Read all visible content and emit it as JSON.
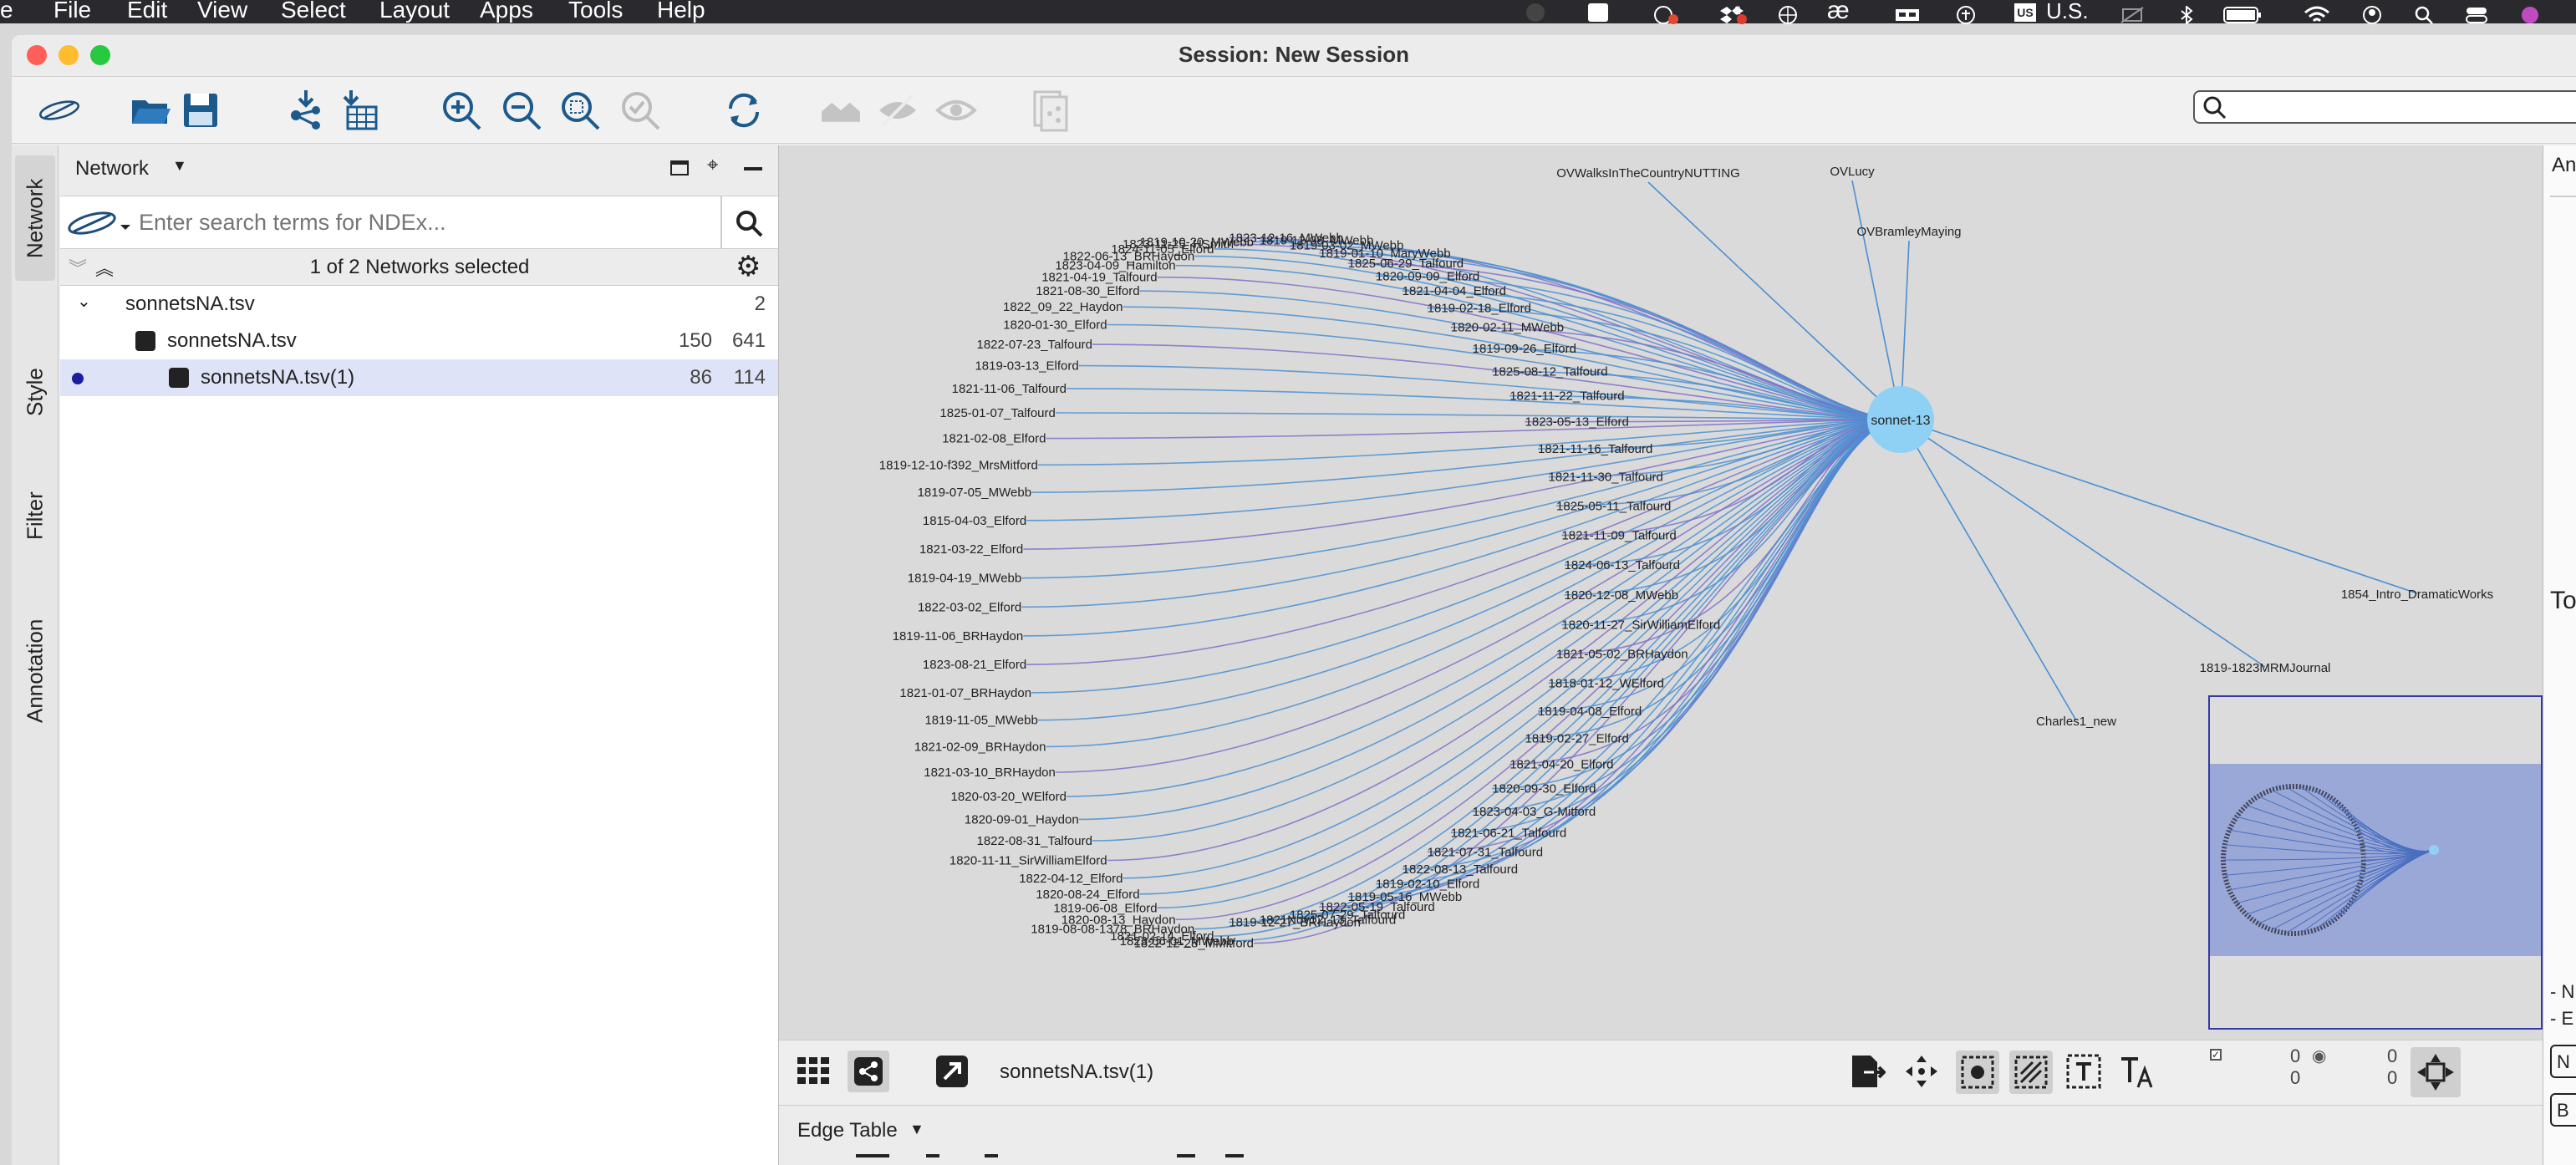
{
  "menubar": {
    "app_fragment": "e",
    "items": [
      "File",
      "Edit",
      "View",
      "Select",
      "Layout",
      "Apps",
      "Tools",
      "Help"
    ],
    "badge_count": "2",
    "input_source": "U.S."
  },
  "window": {
    "title": "Session: New Session"
  },
  "toolbar": {
    "icons": [
      "ndex-logo-icon",
      "open-folder-icon",
      "save-icon",
      "import-network-icon",
      "import-table-icon",
      "zoom-in-icon",
      "zoom-out-icon",
      "zoom-fit-icon",
      "zoom-selected-icon",
      "refresh-icon",
      "home-icon",
      "hide-icon",
      "show-icon",
      "new-network-icon"
    ]
  },
  "sidetabs": [
    "Network",
    "Style",
    "Filter",
    "Annotation"
  ],
  "network_panel": {
    "header_label": "Network",
    "search_placeholder": "Enter search terms for NDEx...",
    "selected_text": "1 of 2 Networks selected",
    "tree": [
      {
        "label": "sonnetsNA.tsv",
        "count1": "2",
        "count2": ""
      },
      {
        "label": "sonnetsNA.tsv",
        "count1": "150",
        "count2": "641"
      },
      {
        "label": "sonnetsNA.tsv(1)",
        "count1": "86",
        "count2": "114"
      }
    ]
  },
  "graph": {
    "hub": "sonnet-13",
    "left_nodes": [
      "1819-10-20_MWebb",
      "1823-11-25_HSmith",
      "1824-11-05_Elford",
      "1822-06-13_BRHaydon",
      "1823-04-09_Hamilton",
      "1821-04-19_Talfourd",
      "1821-08-30_Elford",
      "1822_09_22_Haydon",
      "1820-01-30_Elford",
      "1822-07-23_Talfourd",
      "1819-03-13_Elford",
      "1821-11-06_Talfourd",
      "1825-01-07_Talfourd",
      "1821-02-08_Elford",
      "1819-12-10-f392_MrsMitford",
      "1819-07-05_MWebb",
      "1815-04-03_Elford",
      "1821-03-22_Elford",
      "1819-04-19_MWebb",
      "1822-03-02_Elford",
      "1819-11-06_BRHaydon",
      "1823-08-21_Elford",
      "1821-01-07_BRHaydon",
      "1819-11-05_MWebb",
      "1821-02-09_BRHaydon",
      "1821-03-10_BRHaydon",
      "1820-03-20_WElford",
      "1820-09-01_Haydon",
      "1822-08-31_Talfourd",
      "1820-11-11_SirWilliamElford",
      "1822-04-12_Elford",
      "1820-08-24_Elford",
      "1819-06-08_Elford",
      "1820-08-13_Haydon",
      "1819-08-08-1378_BRHaydon",
      "1821-02-14_Elford",
      "1823-06-01_MWebb",
      "1822-12-28_MMitford"
    ],
    "right_nodes": [
      "1823-12-16_MWebb",
      "1819-12-08_MWebb",
      "1819-03-02_MWebb",
      "1819-01-10_MaryWebb",
      "1825-06-29_Talfourd",
      "1820-09-09_Elford",
      "1821-04-04_Elford",
      "1819-02-18_Elford",
      "1820-02-11_MWebb",
      "1819-09-26_Elford",
      "1825-08-12_Talfourd",
      "1821-11-22_Talfourd",
      "1823-05-13_Elford",
      "1821-11-16_Talfourd",
      "1821-11-30_Talfourd",
      "1825-05-11_Talfourd",
      "1821-11-09_Talfourd",
      "1824-06-13_Talfourd",
      "1820-12-08_MWebb",
      "1820-11-27_SirWilliamElford",
      "1821-05-02_BRHaydon",
      "1818-01-12_WElford",
      "1819-04-08_Elford",
      "1819-02-27_Elford",
      "1821-04-20_Elford",
      "1820-09-30_Elford",
      "1823-04-03_G-Mitford",
      "1821-06-21_Talfourd",
      "1821-07-31_Talfourd",
      "1822-08-13_Talfourd",
      "1819-02-10_Elford",
      "1819-05-16_MWebb",
      "1822-05-19_Talfourd",
      "1825-07-29_Talfourd",
      "1821Nov12_13_Talfourd",
      "1819-12-27_BRHaydon"
    ],
    "outer_nodes": [
      "OVWalksInTheCountryNUTTING",
      "OVLucy",
      "OVBramleyMaying",
      "1854_Intro_DramaticWorks",
      "1819-1823MRMJournal",
      "Charles1_new"
    ]
  },
  "viewbar": {
    "network_name": "sonnetsNA.tsv(1)",
    "counts": [
      "0",
      "0",
      "0",
      "0"
    ]
  },
  "edge_table": {
    "label": "Edge Table"
  },
  "right_panel": {
    "tab_fragment": "An",
    "text_fragment": "To",
    "row1": "- N",
    "row2": "- E",
    "btn1": "N",
    "btn2": "B"
  },
  "colors": {
    "edge_blue": "#4a8fd1",
    "edge_purple": "#8070c8",
    "hub": "#8fd0f5",
    "node_label_highlight": "#f7b64a",
    "minimap_frame": "#333aa8"
  }
}
